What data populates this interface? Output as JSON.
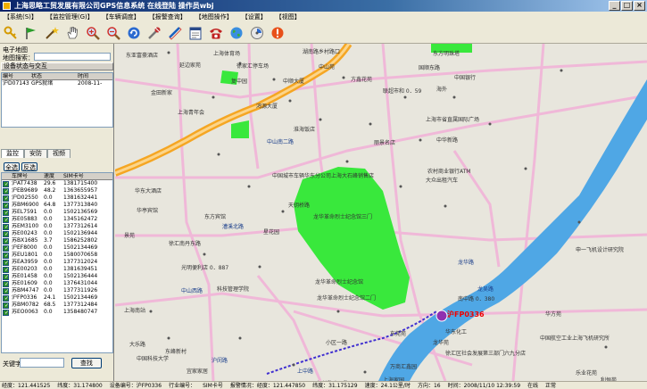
{
  "window": {
    "title": "上海思略工贸发展有限公司GPS信息系统    在线登陆   操作员wbj"
  },
  "menu": [
    "【系统(S)】",
    "【监控管理(G)】",
    "【车辆调度】",
    "【报警查询】",
    "【地图操作】",
    "【设置】",
    "【视图】"
  ],
  "toolbar": {
    "icons": [
      "key-icon",
      "flag-icon",
      "magic-wand-icon",
      "hand-pan-icon",
      "zoom-in-icon",
      "zoom-out-icon",
      "refresh-icon",
      "tools-icon",
      "measure-icon",
      "form-icon",
      "telephone-icon",
      "globe-icon",
      "settings-icon",
      "info-icon"
    ]
  },
  "left_panel": {
    "map_section_label": "电子地图",
    "map_name_label": "地图搜索：",
    "device_section_label": "设备状态与交互",
    "device_headers": [
      "编号",
      "状态",
      "时间"
    ],
    "device_rows": [
      [
        "沪D07143",
        "GPS就绪",
        "2008-11-"
      ]
    ],
    "tabs": [
      "监控",
      "安防",
      "视频"
    ],
    "filter_buttons": [
      "全选",
      "反选"
    ],
    "vehicle_headers": [
      "车牌号",
      "速度",
      "SIM卡号"
    ],
    "vehicles": [
      [
        "沪AT7438",
        "29.6",
        "1381715400"
      ],
      [
        "沪EB9689",
        "48.2",
        "1363655957"
      ],
      [
        "沪D02550",
        "0.0",
        "1381632441"
      ],
      [
        "苏BM6900",
        "64.8",
        "1377313840"
      ],
      [
        "苏EL7591",
        "0.0",
        "1502136569"
      ],
      [
        "苏E05883",
        "0.0",
        "1345162472"
      ],
      [
        "苏EM3100",
        "0.0",
        "1377312614"
      ],
      [
        "苏E00243",
        "0.0",
        "1502136944"
      ],
      [
        "苏BX1685",
        "3.7",
        "1586252802"
      ],
      [
        "沪EF8000",
        "0.0",
        "1502134469"
      ],
      [
        "苏EU1801",
        "0.0",
        "1580070658"
      ],
      [
        "苏EA3959",
        "0.0",
        "1377312024"
      ],
      [
        "苏E00203",
        "0.0",
        "1381639451"
      ],
      [
        "苏E01458",
        "0.0",
        "1502136444"
      ],
      [
        "苏E01609",
        "0.0",
        "1376431044"
      ],
      [
        "苏BM4747",
        "0.0",
        "1377311926"
      ],
      [
        "沪FP0336",
        "24.1",
        "1502134469"
      ],
      [
        "苏BM0782",
        "68.5",
        "1377312484"
      ],
      [
        "苏EO0063",
        "0.0",
        "1358480747"
      ]
    ],
    "keyword_label": "关键字",
    "search_button": "查找"
  },
  "map": {
    "vehicle_label": "沪FP0336",
    "places": [
      [
        "东亚富豪酒店",
        12,
        8
      ],
      [
        "上海体育场",
        110,
        6
      ],
      [
        "湖南路乡村路口",
        210,
        4
      ],
      [
        "东方明珠塔",
        356,
        6
      ],
      [
        "延边家苑",
        72,
        19
      ],
      [
        "徐家汇停车场",
        136,
        20
      ],
      [
        "中山苑",
        228,
        21
      ],
      [
        "国顺东路",
        340,
        22
      ],
      [
        "复中园",
        130,
        37
      ],
      [
        "方鑫花苑",
        264,
        35
      ],
      [
        "中国银行",
        380,
        33
      ],
      [
        "金田新家",
        40,
        50
      ],
      [
        "中顺大厦",
        188,
        37
      ],
      [
        "海外",
        360,
        46
      ],
      [
        "联超市和 0．59",
        300,
        48
      ],
      [
        "上海青年会",
        70,
        72
      ],
      [
        "鸿源大厦",
        158,
        65
      ],
      [
        "上海市省直属国际广场",
        348,
        80
      ],
      [
        "淮海饭店",
        200,
        91
      ],
      [
        "中华新路",
        360,
        103
      ],
      [
        "丽景名店",
        290,
        106
      ],
      [
        "中国城市车辆华东分公司上海大石峰销售店",
        176,
        143
      ],
      [
        "农村商业银行ATM",
        350,
        138
      ],
      [
        "大众出租汽车",
        348,
        148
      ],
      [
        "华东大酒店",
        22,
        160
      ],
      [
        "华亭宾馆",
        24,
        182
      ],
      [
        "天钥桥路",
        194,
        176
      ],
      [
        "龙华革命烈士纪念馆三门",
        222,
        189
      ],
      [
        "景苑",
        10,
        210
      ],
      [
        "东方宾馆",
        100,
        189
      ],
      [
        "徐汇南丹东路",
        60,
        219
      ],
      [
        "光明便利店 0．887",
        74,
        246
      ],
      [
        "星花园",
        166,
        206
      ],
      [
        "龙华革命烈士纪念馆",
        224,
        262
      ],
      [
        "龙华革命烈士纪念馆二门",
        226,
        280
      ],
      [
        "南中路 0．380",
        384,
        281
      ],
      [
        "申一飞机设计研究院",
        516,
        226
      ],
      [
        "科技管理学院",
        114,
        270
      ],
      [
        "上海南站",
        10,
        294
      ],
      [
        "华方苑",
        482,
        298
      ],
      [
        "华东化工",
        370,
        318
      ],
      [
        "东莞苑",
        308,
        320
      ],
      [
        "龙华苑",
        356,
        330
      ],
      [
        "中国航空工业上海飞机研究所",
        476,
        325
      ],
      [
        "小区一路",
        236,
        330
      ],
      [
        "大乐路",
        16,
        332
      ],
      [
        "中国科技大学",
        24,
        348
      ],
      [
        "徐汇区社会发展第三部门六九分店",
        370,
        342
      ],
      [
        "万商汇鑫园",
        308,
        357
      ],
      [
        "东峰新村",
        56,
        340
      ],
      [
        "上海家园",
        300,
        372
      ],
      [
        "宜家家居",
        80,
        362
      ],
      [
        "行健路中二路",
        226,
        376
      ],
      [
        "利恒苑",
        544,
        372
      ],
      [
        "乐业花苑",
        516,
        364
      ]
    ],
    "roads": [
      [
        "中山南二路",
        170,
        105
      ],
      [
        "漕溪北路",
        120,
        200
      ],
      [
        "龙华路",
        384,
        240
      ],
      [
        "龙吴路",
        406,
        270
      ],
      [
        "中山西路",
        74,
        272
      ],
      [
        "沪闵路",
        108,
        350
      ],
      [
        "上中路",
        204,
        362
      ]
    ]
  },
  "status": {
    "items": [
      "经度：121.441525",
      "纬度：31.174800",
      "设备编号：沪FP0336",
      "行业编号：",
      "SIM卡号",
      "报警情况：经度：121.447850",
      "纬度：31.175129",
      "速度：24.1公里/时",
      "方向：16",
      "时间：2008/11/10 12:39:59",
      "在线",
      "正常"
    ]
  },
  "colors": {
    "titlebar": "#0a246a",
    "park": "#39e83c",
    "river": "#4fa7e5",
    "highway": "#f5a623",
    "road": "#f0b8d8"
  }
}
